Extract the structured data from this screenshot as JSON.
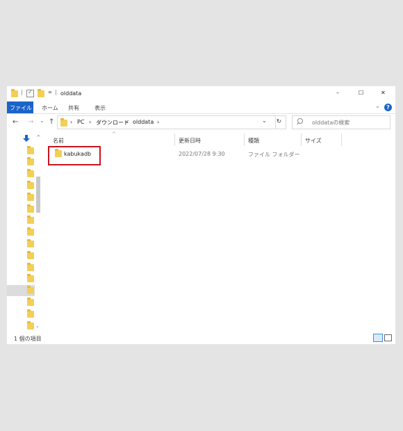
{
  "window": {
    "title": "olddata",
    "controls": {
      "minimize": "–",
      "maximize": "☐",
      "close": "✕"
    }
  },
  "ribbon": {
    "tabs": [
      "ファイル",
      "ホーム",
      "共有",
      "表示"
    ],
    "collapse": "⌄",
    "help": "?"
  },
  "nav": {
    "back": "←",
    "forward": "→",
    "recent": "⌄",
    "up": "↑",
    "breadcrumb": [
      "PC",
      "ダウンロード",
      "olddata"
    ],
    "separator": "›",
    "dropdown": "⌄",
    "refresh": "↻",
    "search_placeholder": "olddataの検索"
  },
  "columns": {
    "name": "名前",
    "modified": "更新日時",
    "type": "種類",
    "size": "サイズ",
    "sort_arrow": "^"
  },
  "files": [
    {
      "name": "kabukadb",
      "modified": "2022/07/28 9:30",
      "type": "ファイル フォルダー",
      "size": ""
    }
  ],
  "status": {
    "count": "1 個の項目"
  },
  "colors": {
    "file_tab": "#1a64c8",
    "highlight_box": "#c8141e",
    "folder": "#f3cf58",
    "nav_selected": "#dcdcdc",
    "help": "#1a64c8"
  },
  "icons": {
    "title_folder": "folder-icon",
    "quick_properties": "checkbox-icon",
    "quick_new_folder": "folder-icon",
    "pin": "pin-arrow-icon",
    "search": "search-icon",
    "details_view": "details-view-icon",
    "large_icons": "large-icons-icon"
  }
}
